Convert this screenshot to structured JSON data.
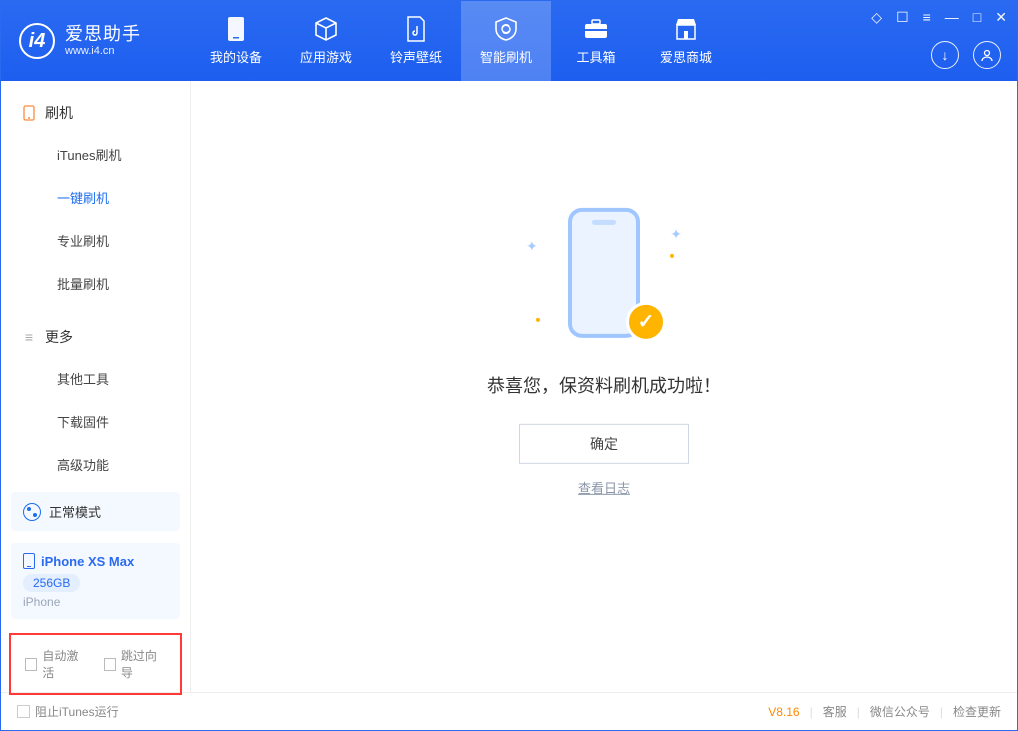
{
  "app": {
    "title": "爱思助手",
    "subtitle": "www.i4.cn"
  },
  "tabs": {
    "device": "我的设备",
    "apps": "应用游戏",
    "ringtone": "铃声壁纸",
    "flash": "智能刷机",
    "toolbox": "工具箱",
    "store": "爱思商城"
  },
  "sidebar": {
    "flash_header": "刷机",
    "items": {
      "itunes": "iTunes刷机",
      "oneclick": "一键刷机",
      "pro": "专业刷机",
      "batch": "批量刷机"
    },
    "more_header": "更多",
    "more": {
      "other": "其他工具",
      "firmware": "下载固件",
      "advanced": "高级功能"
    }
  },
  "status": {
    "mode": "正常模式"
  },
  "device": {
    "name": "iPhone XS Max",
    "storage": "256GB",
    "type": "iPhone"
  },
  "options": {
    "auto_activate": "自动激活",
    "skip_guide": "跳过向导"
  },
  "main": {
    "success_msg": "恭喜您，保资料刷机成功啦！",
    "ok": "确定",
    "view_log": "查看日志"
  },
  "footer": {
    "block_itunes": "阻止iTunes运行",
    "version": "V8.16",
    "service": "客服",
    "wechat": "微信公众号",
    "update": "检查更新"
  }
}
